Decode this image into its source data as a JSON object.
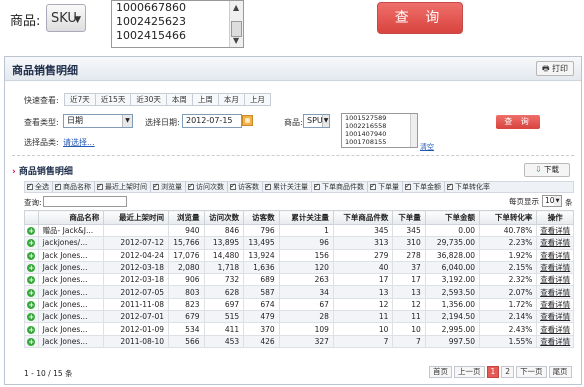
{
  "zoom": {
    "product_label": "商品:",
    "product_type_value": "SKU",
    "sku_lines": [
      "1000667860",
      "1002425623",
      "1002415466"
    ],
    "query_button": "查 询"
  },
  "panel": {
    "title": "商品销售明细",
    "print_button": "打印",
    "quick_label": "快速查看:",
    "quick_ranges": [
      "近7天",
      "近15天",
      "近30天",
      "本周",
      "上周",
      "本月",
      "上月"
    ],
    "view_type_label": "查看类型:",
    "view_type_value": "日期",
    "date_label": "选择日期:",
    "date_value": "2012-07-15",
    "product_label": "商品:",
    "product_type_value": "SPU",
    "sku_lines": [
      "1001527589",
      "1002216558",
      "1001407940",
      "1001708155"
    ],
    "clear_link": "清空",
    "query_button": "查 询",
    "category_label": "选择品类:",
    "category_link": "请选择..."
  },
  "detail": {
    "title": "商品销售明细",
    "download_button": "下载",
    "columns_toggle": [
      {
        "label": "全选",
        "checked": true
      },
      {
        "label": "商品名称",
        "checked": true
      },
      {
        "label": "最近上架时间",
        "checked": true
      },
      {
        "label": "浏览量",
        "checked": true
      },
      {
        "label": "访问次数",
        "checked": true
      },
      {
        "label": "访客数",
        "checked": true
      },
      {
        "label": "累计关注量",
        "checked": true
      },
      {
        "label": "下单商品件数",
        "checked": true
      },
      {
        "label": "下单量",
        "checked": true
      },
      {
        "label": "下单金额",
        "checked": true
      },
      {
        "label": "下单转化率",
        "checked": true
      }
    ],
    "search_label": "查询:",
    "per_page_label": "每页显示",
    "per_page_value": "10",
    "per_page_unit": "条",
    "headers": [
      "商品名称",
      "最近上架时间",
      "浏览量",
      "访问次数",
      "访客数",
      "累计关注量",
      "下单商品件数",
      "下单量",
      "下单金额",
      "下单转化率",
      "操作"
    ],
    "rows": [
      [
        "赠品- Jack&J...",
        "",
        "940",
        "846",
        "796",
        "1",
        "345",
        "345",
        "0.00",
        "40.78%",
        "查看详情"
      ],
      [
        "jackjones/...",
        "2012-07-12",
        "15,766",
        "13,895",
        "13,495",
        "96",
        "313",
        "310",
        "29,735.00",
        "2.23%",
        "查看详情"
      ],
      [
        "Jack Jones...",
        "2012-04-24",
        "17,076",
        "14,480",
        "13,924",
        "156",
        "279",
        "278",
        "36,828.00",
        "1.92%",
        "查看详情"
      ],
      [
        "Jack Jones...",
        "2012-03-18",
        "2,080",
        "1,718",
        "1,636",
        "120",
        "40",
        "37",
        "6,040.00",
        "2.15%",
        "查看详情"
      ],
      [
        "Jack Jones...",
        "2012-03-18",
        "906",
        "732",
        "689",
        "263",
        "17",
        "17",
        "3,192.00",
        "2.32%",
        "查看详情"
      ],
      [
        "Jack Jones...",
        "2012-07-05",
        "803",
        "628",
        "587",
        "34",
        "13",
        "13",
        "2,593.50",
        "2.07%",
        "查看详情"
      ],
      [
        "Jack Jones...",
        "2011-11-08",
        "823",
        "697",
        "674",
        "67",
        "12",
        "12",
        "1,356.00",
        "1.72%",
        "查看详情"
      ],
      [
        "Jack Jones...",
        "2012-07-01",
        "679",
        "515",
        "479",
        "28",
        "11",
        "11",
        "2,194.50",
        "2.14%",
        "查看详情"
      ],
      [
        "Jack Jones...",
        "2012-01-09",
        "534",
        "411",
        "370",
        "109",
        "10",
        "10",
        "2,995.00",
        "2.43%",
        "查看详情"
      ],
      [
        "Jack Jones...",
        "2011-08-10",
        "566",
        "453",
        "426",
        "327",
        "7",
        "7",
        "997.50",
        "1.55%",
        "查看详情"
      ]
    ],
    "total_text": "1 - 10 / 15 条",
    "pager": [
      "首页",
      "上一页",
      "1",
      "2",
      "下一页",
      "尾页"
    ],
    "current_page": "1"
  }
}
